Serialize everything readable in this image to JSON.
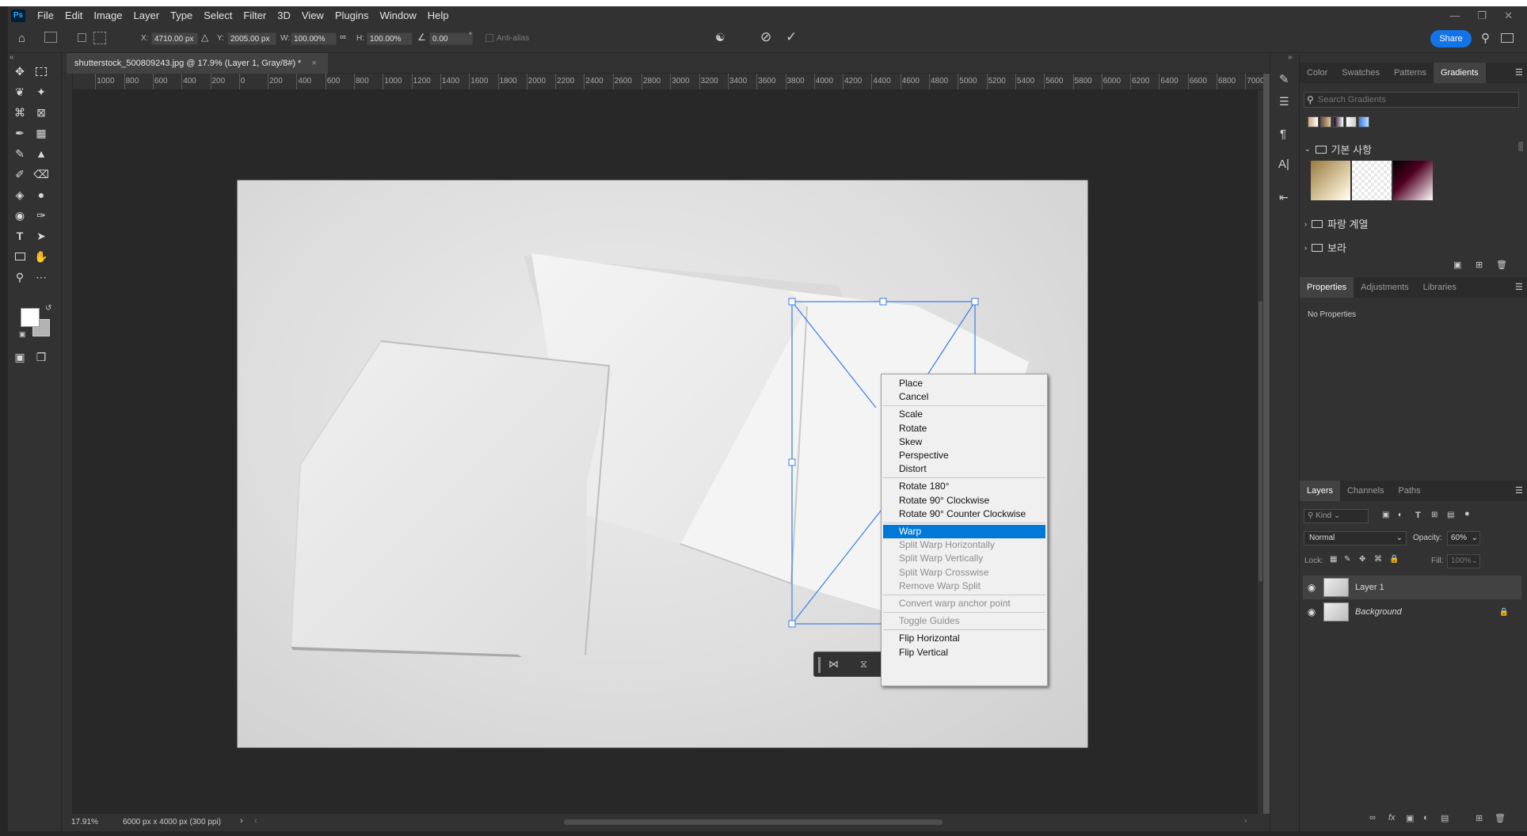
{
  "app": {
    "logo": "Ps"
  },
  "menubar": {
    "items": [
      "File",
      "Edit",
      "Image",
      "Layer",
      "Type",
      "Select",
      "Filter",
      "3D",
      "View",
      "Plugins",
      "Window",
      "Help"
    ]
  },
  "options": {
    "x_label": "X:",
    "x_value": "4710.00 px",
    "y_label": "Y:",
    "y_value": "2005.00 px",
    "w_label": "W:",
    "w_value": "100.00%",
    "h_label": "H:",
    "h_value": "100.00%",
    "angle_value": "0.00",
    "angle_unit": "°",
    "antialias_label": "Anti-alias",
    "share_label": "Share"
  },
  "document": {
    "tab_title": "shutterstock_500809243.jpg @ 17.9% (Layer 1, Gray/8#) *",
    "zoom": "17.91%",
    "doc_info": "6000 px x 4000 px (300 ppi)"
  },
  "ruler": {
    "ticks": [
      "0",
      "1000",
      "800",
      "600",
      "400",
      "200",
      "0",
      "200",
      "400",
      "600",
      "800",
      "1000",
      "1200",
      "1400",
      "1600",
      "1800",
      "2000",
      "2200",
      "2400",
      "2600",
      "2800",
      "3000",
      "3200",
      "3400",
      "3600",
      "3800",
      "4000",
      "4200",
      "4400",
      "4600",
      "4800",
      "5000",
      "5200",
      "5400",
      "5600",
      "5800",
      "6000",
      "6200",
      "6400",
      "6600",
      "6800",
      "7000"
    ]
  },
  "context_menu": {
    "groups": [
      [
        {
          "label": "Place",
          "state": "enabled"
        },
        {
          "label": "Cancel",
          "state": "enabled"
        }
      ],
      [
        {
          "label": "Scale",
          "state": "enabled"
        },
        {
          "label": "Rotate",
          "state": "enabled"
        },
        {
          "label": "Skew",
          "state": "enabled"
        },
        {
          "label": "Perspective",
          "state": "enabled"
        },
        {
          "label": "Distort",
          "state": "enabled"
        }
      ],
      [
        {
          "label": "Rotate 180°",
          "state": "enabled"
        },
        {
          "label": "Rotate 90° Clockwise",
          "state": "enabled"
        },
        {
          "label": "Rotate 90° Counter Clockwise",
          "state": "enabled"
        }
      ],
      [
        {
          "label": "Warp",
          "state": "highlighted"
        },
        {
          "label": "Split Warp Horizontally",
          "state": "disabled"
        },
        {
          "label": "Split Warp Vertically",
          "state": "disabled"
        },
        {
          "label": "Split Warp Crosswise",
          "state": "disabled"
        },
        {
          "label": "Remove Warp Split",
          "state": "disabled"
        }
      ],
      [
        {
          "label": "Convert warp anchor point",
          "state": "disabled"
        }
      ],
      [
        {
          "label": "Toggle Guides",
          "state": "disabled"
        }
      ],
      [
        {
          "label": "Flip Horizontal",
          "state": "enabled"
        },
        {
          "label": "Flip Vertical",
          "state": "enabled"
        }
      ]
    ]
  },
  "gradients_panel": {
    "tabs": [
      "Color",
      "Swatches",
      "Patterns",
      "Gradients"
    ],
    "active_tab": "Gradients",
    "search_placeholder": "Search Gradients",
    "folders": [
      "기본 사항",
      "파랑 계열",
      "보라"
    ]
  },
  "properties_panel": {
    "tabs": [
      "Properties",
      "Adjustments",
      "Libraries"
    ],
    "active_tab": "Properties",
    "empty_text": "No Properties"
  },
  "layers_panel": {
    "tabs": [
      "Layers",
      "Channels",
      "Paths"
    ],
    "active_tab": "Layers",
    "filter_label": "Kind",
    "blend_mode": "Normal",
    "opacity_label": "Opacity:",
    "opacity_value": "60%",
    "lock_label": "Lock:",
    "fill_label": "Fill:",
    "fill_value": "100%",
    "layers": [
      {
        "name": "Layer 1",
        "selected": true,
        "visible": true,
        "locked": false
      },
      {
        "name": "Background",
        "selected": false,
        "visible": true,
        "locked": true
      }
    ]
  },
  "colors": {
    "selection_blue": "#0078d7",
    "transform_blue": "#3a7ee6",
    "share_blue": "#1473e6",
    "foreground": "#ffffff",
    "background": "#b3b3b3"
  }
}
